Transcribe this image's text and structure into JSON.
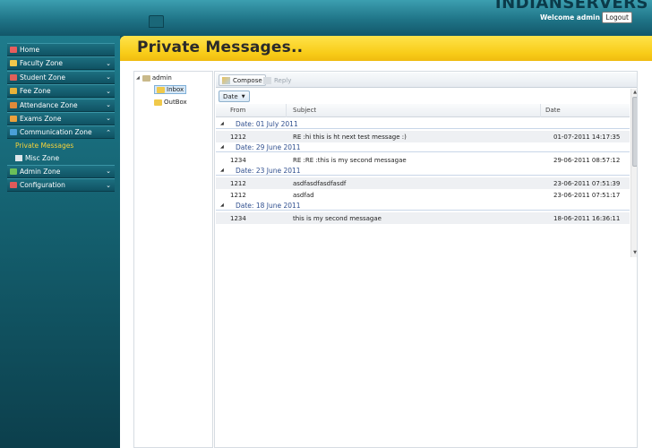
{
  "header": {
    "brand": "INDIANSERVERS",
    "welcome": "Welcome admin !",
    "logout_label": "Logout"
  },
  "sidebar": {
    "items": [
      {
        "label": "Home",
        "icon": "home-icon",
        "color": "#e85d5d"
      },
      {
        "label": "Faculty Zone",
        "icon": "faculty-icon",
        "color": "#f2c94c"
      },
      {
        "label": "Student Zone",
        "icon": "student-icon",
        "color": "#e0605a"
      },
      {
        "label": "Fee Zone",
        "icon": "fee-icon",
        "color": "#e8b23a"
      },
      {
        "label": "Attendance Zone",
        "icon": "attendance-icon",
        "color": "#e08a3a"
      },
      {
        "label": "Exams Zone",
        "icon": "exams-icon",
        "color": "#e9a13d"
      },
      {
        "label": "Communication Zone",
        "icon": "communication-icon",
        "color": "#4aa0d8"
      }
    ],
    "subitems": [
      {
        "label": "Private Messages",
        "active": true
      },
      {
        "label": "Misc Zone",
        "active": false
      }
    ],
    "items2": [
      {
        "label": "Admin Zone",
        "icon": "admin-icon",
        "color": "#6bbf59"
      },
      {
        "label": "Configuration",
        "icon": "configuration-icon",
        "color": "#e05a5a"
      }
    ]
  },
  "main": {
    "title": "Private Messages.."
  },
  "tree": {
    "root": "admin",
    "inbox": "Inbox",
    "outbox": "OutBox"
  },
  "toolbar": {
    "compose": "Compose",
    "reply": "Reply"
  },
  "grid": {
    "group_by": "Date",
    "columns": [
      "From",
      "Subject",
      "Date"
    ],
    "groups": [
      {
        "label": "Date: 01 July 2011",
        "rows": [
          {
            "from": "1212",
            "subject": "RE :hi this is ht next test message :)",
            "date": "01-07-2011 14:17:35"
          }
        ]
      },
      {
        "label": "Date: 29 June 2011",
        "rows": [
          {
            "from": "1234",
            "subject": "RE :RE :this is my second messagae",
            "date": "29-06-2011 08:57:12"
          }
        ]
      },
      {
        "label": "Date: 23 June 2011",
        "rows": [
          {
            "from": "1212",
            "subject": "asdfasdfasdfasdf",
            "date": "23-06-2011 07:51:39"
          },
          {
            "from": "1212",
            "subject": "asdfad",
            "date": "23-06-2011 07:51:17"
          }
        ]
      },
      {
        "label": "Date: 18 June 2011",
        "rows": [
          {
            "from": "1234",
            "subject": "this is my second messagae",
            "date": "18-06-2011 16:36:11"
          }
        ]
      }
    ]
  }
}
